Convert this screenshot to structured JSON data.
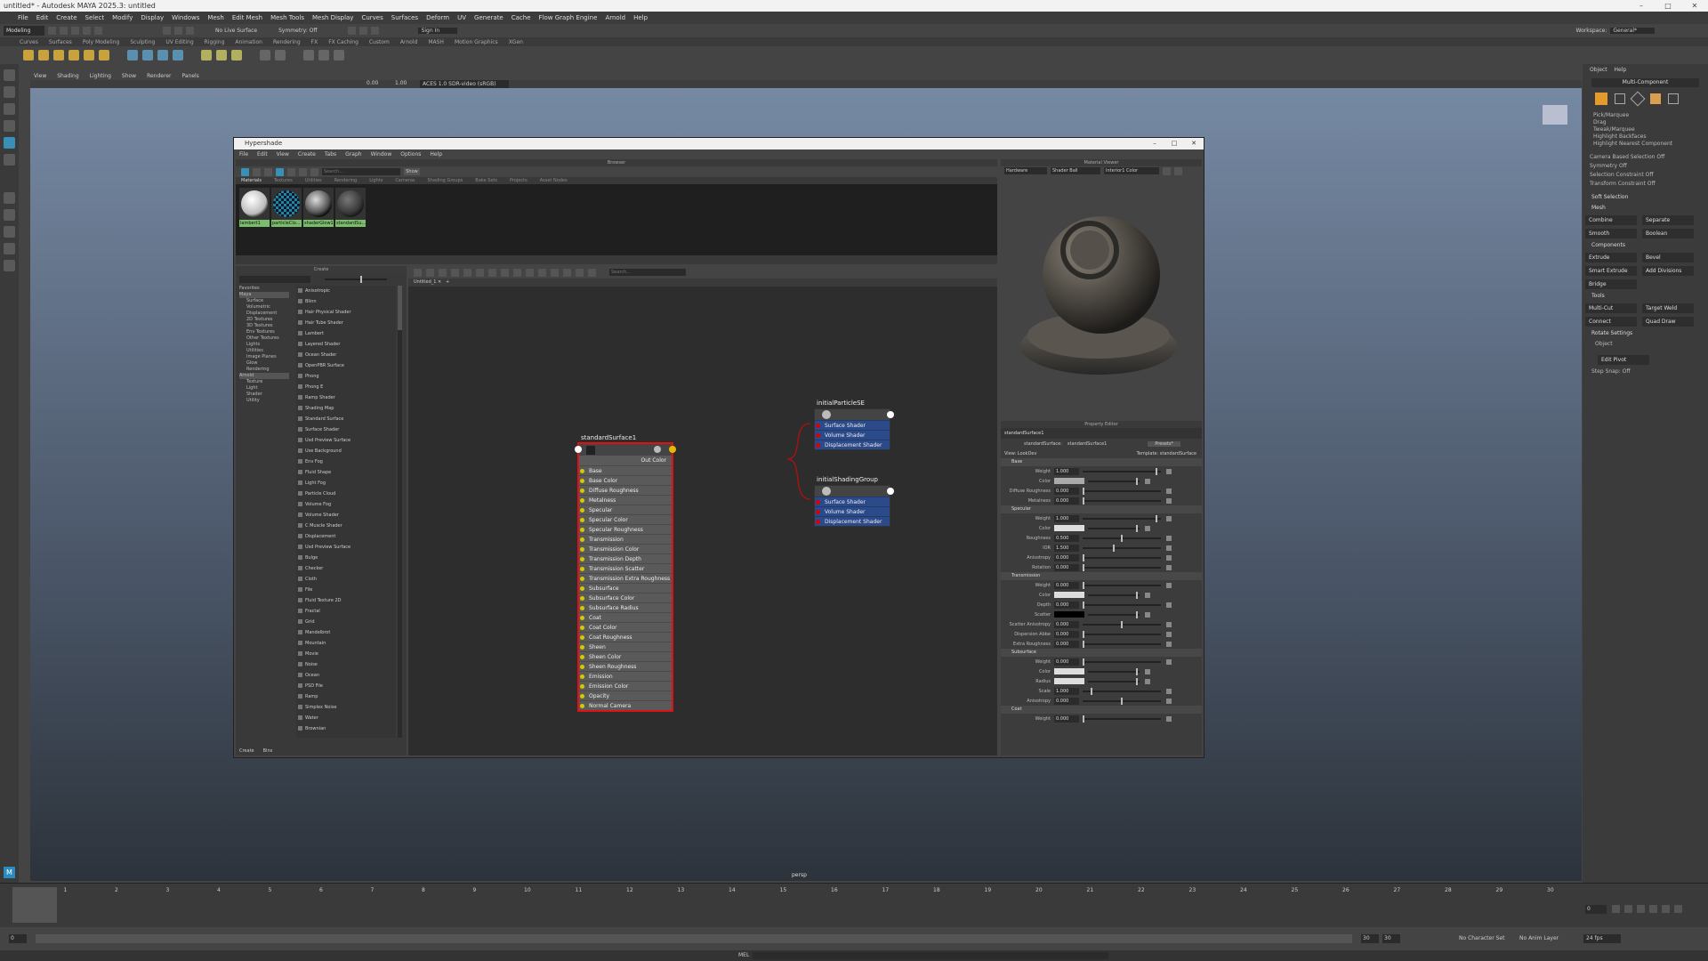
{
  "window": {
    "title": "untitled* - Autodesk MAYA 2025.3: untitled"
  },
  "menubar": [
    "File",
    "Edit",
    "Create",
    "Select",
    "Modify",
    "Display",
    "Windows",
    "Mesh",
    "Edit Mesh",
    "Mesh Tools",
    "Mesh Display",
    "Curves",
    "Surfaces",
    "Deform",
    "UV",
    "Generate",
    "Cache",
    "Flow Graph Engine",
    "Arnold",
    "Help"
  ],
  "status": {
    "mode": "Modeling",
    "live": "No Live Surface",
    "symmetry": "Symmetry: Off",
    "signin": "Sign In",
    "workspace_label": "Workspace:",
    "workspace": "General*"
  },
  "shelf_tabs": [
    "Curves",
    "Surfaces",
    "Poly Modeling",
    "Sculpting",
    "UV Editing",
    "Rigging",
    "Animation",
    "Rendering",
    "FX",
    "FX Caching",
    "Custom",
    "Arnold",
    "MASH",
    "Motion Graphics",
    "XGen"
  ],
  "viewport": {
    "menu": [
      "View",
      "Shading",
      "Lighting",
      "Show",
      "Renderer",
      "Panels"
    ],
    "colorspace": "ACES 1.0 SDR-video (sRGB)",
    "val1": "0.00",
    "val2": "1.00",
    "camera": "persp"
  },
  "right_panel": {
    "tabs": [
      "Object",
      "Help"
    ],
    "mode": "Multi-Component",
    "options": [
      "Pick/Marquee",
      "Drag",
      "Tweak/Marquee",
      "Highlight Backfaces",
      "Highlight Nearest Component"
    ],
    "props": [
      "Camera Based Selection",
      "Symmetry",
      "Selection Constraint",
      "Transform Constraint"
    ],
    "soft": "Soft Selection",
    "mesh": "Mesh",
    "mesh_btns": [
      "Combine",
      "Separate",
      "Smooth",
      "Boolean"
    ],
    "components": "Components",
    "comp_btns": [
      "Extrude",
      "Bevel",
      "Smart Extrude",
      "Add Divisions",
      "Bridge"
    ],
    "tools": "Tools",
    "tool_btns": [
      "Multi-Cut",
      "Target Weld",
      "Connect",
      "Quad Draw"
    ],
    "rotate": "Rotate Settings",
    "object": "Object",
    "edit_pivot": "Edit Pivot",
    "step": "Step Snap:",
    "off": "Off"
  },
  "timeline": {
    "ticks": [
      "0",
      "1",
      "2",
      "3",
      "4",
      "5",
      "6",
      "7",
      "8",
      "9",
      "10",
      "11",
      "12",
      "13",
      "14",
      "15",
      "16",
      "17",
      "18",
      "19",
      "20",
      "21",
      "22",
      "23",
      "24",
      "25",
      "26",
      "27",
      "28",
      "29",
      "30"
    ],
    "current": "0",
    "start": "1",
    "end": "30",
    "char_set": "No Character Set",
    "anim_layer": "No Anim Layer",
    "fps": "24 fps"
  },
  "cmd": {
    "lang": "MEL"
  },
  "hypershade": {
    "title": "Hypershade",
    "menu": [
      "File",
      "Edit",
      "View",
      "Create",
      "Tabs",
      "Graph",
      "Window",
      "Options",
      "Help"
    ],
    "browser_label": "Browser",
    "search_placeholder": "Search...",
    "show": "Show",
    "browser_tabs": [
      "Materials",
      "Textures",
      "Utilities",
      "Rendering",
      "Lights",
      "Cameras",
      "Shading Groups",
      "Bake Sets",
      "Projects",
      "Asset Nodes"
    ],
    "swatches": [
      "lambert1",
      "particleClo...",
      "shaderGlow1",
      "standardSu..."
    ],
    "create_label": "Create",
    "categories": [
      "Favorites",
      "Maya",
      "Surface",
      "Volumetric",
      "Displacement",
      "2D Textures",
      "3D Textures",
      "Env Textures",
      "Other Textures",
      "Lights",
      "Utilities",
      "Image Planes",
      "Glow",
      "Rendering",
      "Arnold",
      "Texture",
      "Light",
      "Shader",
      "Utility"
    ],
    "create_items": [
      "Anisotropic",
      "Blinn",
      "Hair Physical Shader",
      "Hair Tube Shader",
      "Lambert",
      "Layered Shader",
      "Ocean Shader",
      "OpenPBR Surface",
      "Phong",
      "Phong E",
      "Ramp Shader",
      "Shading Map",
      "Standard Surface",
      "Surface Shader",
      "Usd Preview Surface",
      "Use Background",
      "Env Fog",
      "Fluid Shape",
      "Light Fog",
      "Particle Cloud",
      "Volume Fog",
      "Volume Shader",
      "C Muscle Shader",
      "Displacement",
      "Usd Preview Surface",
      "Bulge",
      "Checker",
      "Cloth",
      "File",
      "Fluid Texture 2D",
      "Fractal",
      "Grid",
      "Mandelbrot",
      "Mountain",
      "Movie",
      "Noise",
      "Ocean",
      "PSD File",
      "Ramp",
      "Simplex Noise",
      "Water",
      "Brownian"
    ],
    "create_foot": [
      "Create",
      "Bins"
    ],
    "graph_tab": "Untitled_1",
    "graph_search": "Search...",
    "node_main": {
      "name": "standardSurface1",
      "out": "Out Color",
      "attrs": [
        "Base",
        "Base Color",
        "Diffuse Roughness",
        "Metalness",
        "Specular",
        "Specular Color",
        "Specular Roughness",
        "Transmission",
        "Transmission Color",
        "Transmission Depth",
        "Transmission Scatter",
        "Transmission Extra Roughness",
        "Subsurface",
        "Subsurface Color",
        "Subsurface Radius",
        "Coat",
        "Coat Color",
        "Coat Roughness",
        "Sheen",
        "Sheen Color",
        "Sheen Roughness",
        "Emission",
        "Emission Color",
        "Opacity",
        "Normal Camera"
      ]
    },
    "node_sg1": {
      "name": "initialParticleSE",
      "attrs": [
        "Surface Shader",
        "Volume Shader",
        "Displacement Shader"
      ]
    },
    "node_sg2": {
      "name": "initialShadingGroup",
      "attrs": [
        "Surface Shader",
        "Volume Shader",
        "Displacement Shader"
      ]
    },
    "mat_viewer": {
      "label": "Material Viewer",
      "renderer": "Hardware",
      "geometry": "Shader Ball",
      "env": "Interior1 Color"
    },
    "prop_editor": {
      "label": "Property Editor",
      "node": "standardSurface1",
      "type_label": "standardSurface:",
      "type_value": "standardSurface1",
      "presets": "Presets*",
      "view": "View: LookDev",
      "template": "Template: standardSurface",
      "sections": [
        {
          "name": "Base",
          "rows": [
            {
              "k": "Weight",
              "v": "1.000",
              "f": 0.95
            },
            {
              "k": "Color",
              "c": "#aaaaaa"
            },
            {
              "k": "Diffuse Roughness",
              "v": "0.000",
              "f": 0
            },
            {
              "k": "Metalness",
              "v": "0.000",
              "f": 0
            }
          ]
        },
        {
          "name": "Specular",
          "rows": [
            {
              "k": "Weight",
              "v": "1.000",
              "f": 0.95
            },
            {
              "k": "Color",
              "c": "#dddddd"
            },
            {
              "k": "Roughness",
              "v": "0.500",
              "f": 0.5
            },
            {
              "k": "IOR",
              "v": "1.500",
              "f": 0.4
            },
            {
              "k": "Anisotropy",
              "v": "0.000",
              "f": 0
            },
            {
              "k": "Rotation",
              "v": "0.000",
              "f": 0
            }
          ]
        },
        {
          "name": "Transmission",
          "rows": [
            {
              "k": "Weight",
              "v": "0.000",
              "f": 0
            },
            {
              "k": "Color",
              "c": "#dddddd"
            },
            {
              "k": "Depth",
              "v": "0.000",
              "f": 0
            },
            {
              "k": "Scatter",
              "c": "#000000"
            },
            {
              "k": "Scatter Anisotropy",
              "v": "0.000",
              "f": 0.5
            },
            {
              "k": "Dispersion Abbe",
              "v": "0.000",
              "f": 0
            },
            {
              "k": "Extra Roughness",
              "v": "0.000",
              "f": 0
            }
          ]
        },
        {
          "name": "Subsurface",
          "rows": [
            {
              "k": "Weight",
              "v": "0.000",
              "f": 0
            },
            {
              "k": "Color",
              "c": "#dddddd"
            },
            {
              "k": "Radius",
              "c": "#dddddd"
            },
            {
              "k": "Scale",
              "v": "1.000",
              "f": 0.1
            },
            {
              "k": "Anisotropy",
              "v": "0.000",
              "f": 0.5
            }
          ]
        },
        {
          "name": "Coat",
          "rows": [
            {
              "k": "Weight",
              "v": "0.000",
              "f": 0
            }
          ]
        }
      ]
    }
  }
}
